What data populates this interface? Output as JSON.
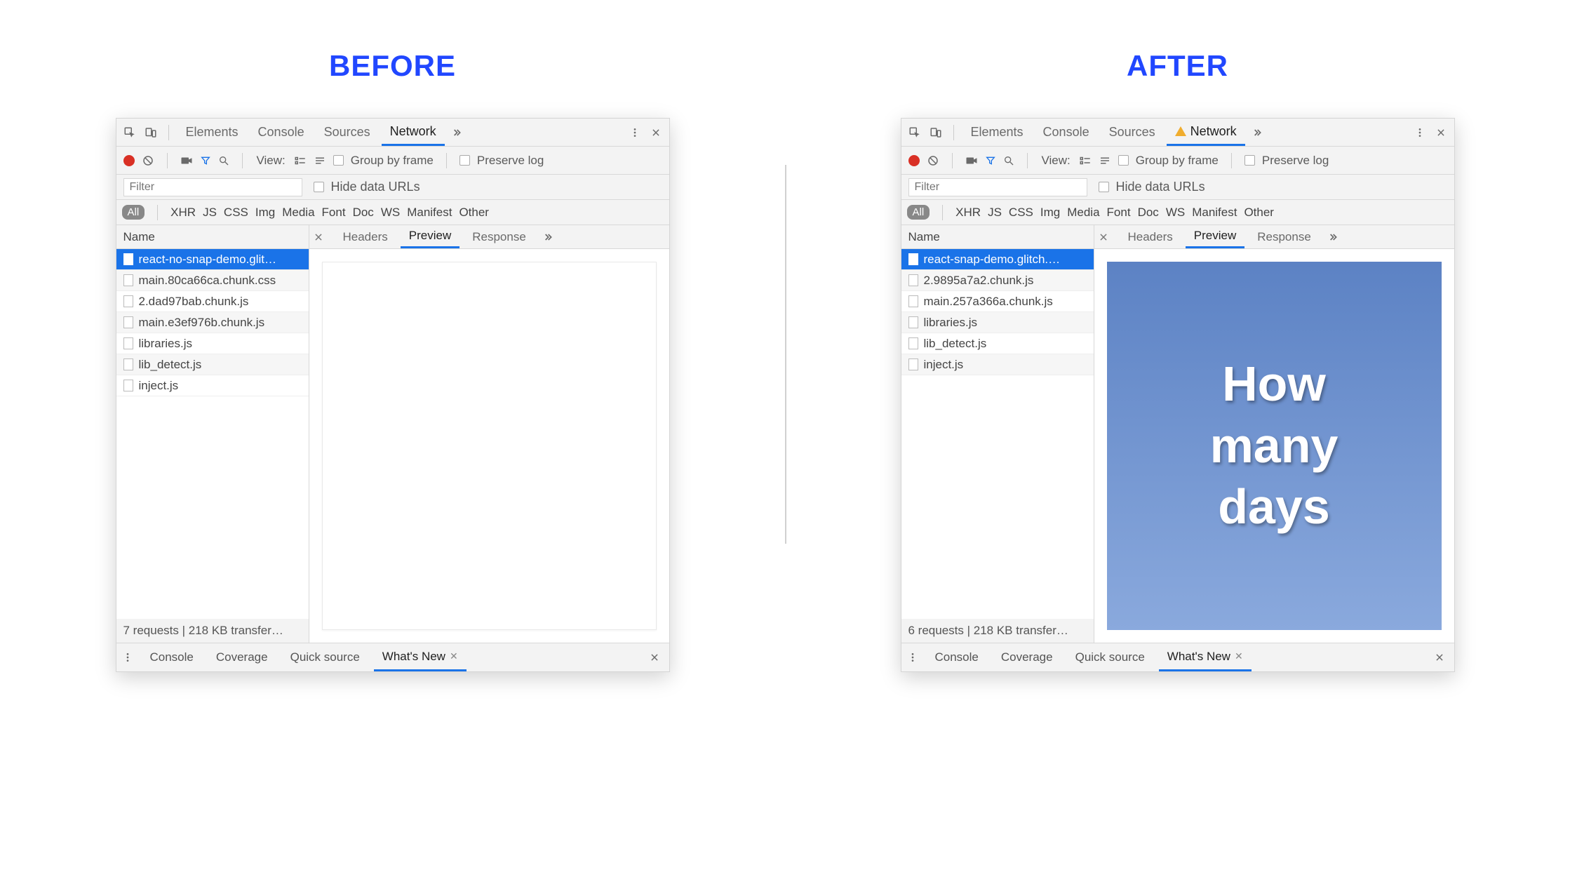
{
  "headings": {
    "before": "BEFORE",
    "after": "AFTER"
  },
  "top_tabs": {
    "elements": "Elements",
    "console": "Console",
    "sources": "Sources",
    "network": "Network"
  },
  "toolbar": {
    "view_label": "View:",
    "group_by_frame": "Group by frame",
    "preserve_log": "Preserve log"
  },
  "filter": {
    "placeholder": "Filter",
    "hide_data_urls": "Hide data URLs"
  },
  "types": {
    "all": "All",
    "xhr": "XHR",
    "js": "JS",
    "css": "CSS",
    "img": "Img",
    "media": "Media",
    "font": "Font",
    "doc": "Doc",
    "ws": "WS",
    "manifest": "Manifest",
    "other": "Other"
  },
  "columns": {
    "name": "Name"
  },
  "detail_tabs": {
    "headers": "Headers",
    "preview": "Preview",
    "response": "Response"
  },
  "drawer": {
    "console": "Console",
    "coverage": "Coverage",
    "quick_source": "Quick source",
    "whats_new": "What's New"
  },
  "before": {
    "requests": [
      "react-no-snap-demo.glit…",
      "main.80ca66ca.chunk.css",
      "2.dad97bab.chunk.js",
      "main.e3ef976b.chunk.js",
      "libraries.js",
      "lib_detect.js",
      "inject.js"
    ],
    "status": "7 requests | 218 KB transfer…",
    "has_warning": false,
    "preview_kind": "blank"
  },
  "after": {
    "requests": [
      "react-snap-demo.glitch.…",
      "2.9895a7a2.chunk.js",
      "main.257a366a.chunk.js",
      "libraries.js",
      "lib_detect.js",
      "inject.js"
    ],
    "status": "6 requests | 218 KB transfer…",
    "has_warning": true,
    "preview_kind": "card",
    "preview_text_lines": [
      "How",
      "many",
      "days"
    ]
  }
}
